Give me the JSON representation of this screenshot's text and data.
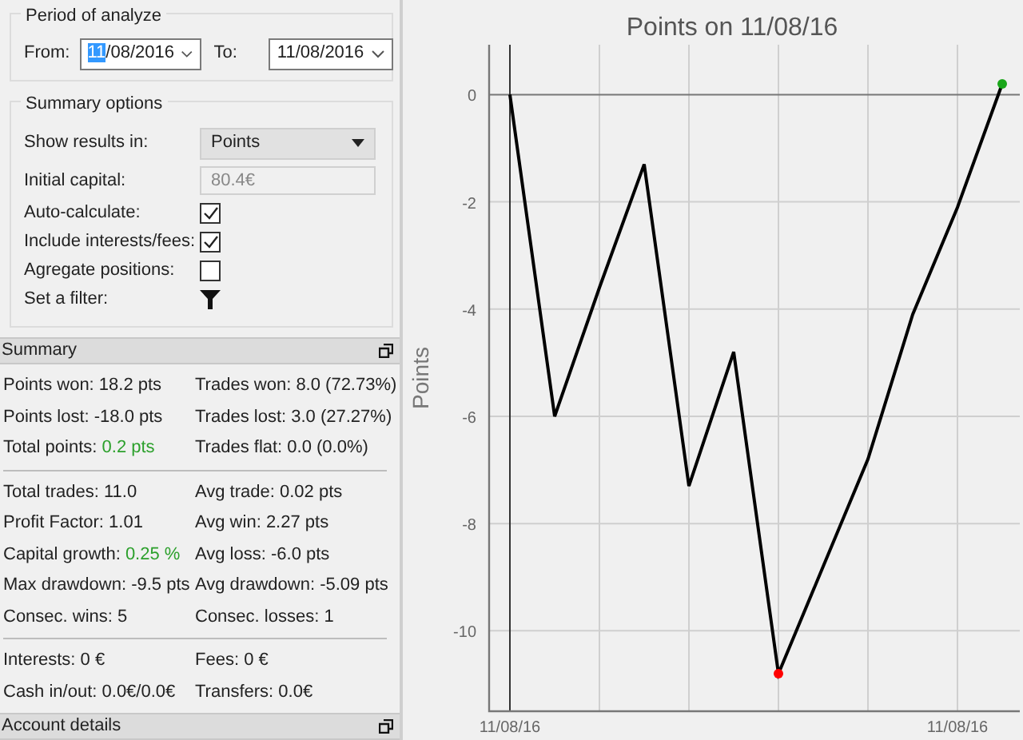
{
  "period": {
    "title": "Period of analyze",
    "from": {
      "label": "From:",
      "day": "11",
      "rest": "/08/2016"
    },
    "to": {
      "label": "To:",
      "value": "11/08/2016"
    }
  },
  "summary_options": {
    "title": "Summary options",
    "rows": [
      {
        "kind": "select",
        "label": "Show results in:",
        "value": "Points"
      },
      {
        "kind": "input",
        "label": "Initial capital:",
        "value": "80.4€",
        "disabled": true
      },
      {
        "kind": "checkbox",
        "label": "Auto-calculate:",
        "checked": true
      },
      {
        "kind": "checkbox",
        "label": "Include interests/fees:",
        "checked": true
      },
      {
        "kind": "checkbox",
        "label": "Agregate positions:",
        "checked": false
      },
      {
        "kind": "filter",
        "label": "Set a filter:"
      }
    ]
  },
  "summary": {
    "title": "Summary",
    "groups": [
      [
        {
          "label": "Points won:",
          "value": "18.2 pts"
        },
        {
          "label": "Trades won:",
          "value": "8.0 (72.73%)"
        },
        {
          "label": "Points lost:",
          "value": "-18.0 pts"
        },
        {
          "label": "Trades lost:",
          "value": "3.0 (27.27%)"
        },
        {
          "label": "Total points:",
          "value": "0.2 pts",
          "color": "#2ca02c"
        },
        {
          "label": "Trades flat:",
          "value": "0.0 (0.0%)"
        }
      ],
      [
        {
          "label": "Total trades:",
          "value": "11.0"
        },
        {
          "label": "Avg trade:",
          "value": "0.02 pts"
        },
        {
          "label": "Profit Factor:",
          "value": "1.01"
        },
        {
          "label": "Avg win:",
          "value": "2.27 pts"
        },
        {
          "label": "Capital growth:",
          "value": "0.25 %",
          "color": "#2ca02c"
        },
        {
          "label": "Avg loss:",
          "value": "-6.0 pts"
        },
        {
          "label": "Max drawdown:",
          "value": "-9.5 pts"
        },
        {
          "label": "Avg drawdown:",
          "value": "-5.09 pts"
        },
        {
          "label": "Consec. wins:",
          "value": "5"
        },
        {
          "label": "Consec. losses:",
          "value": "1"
        }
      ],
      [
        {
          "label": "Interests:",
          "value": "0 €"
        },
        {
          "label": "Fees:",
          "value": "0 €"
        },
        {
          "label": "Cash in/out:",
          "value": "0.0€/0.0€"
        },
        {
          "label": "Transfers:",
          "value": "0.0€"
        }
      ]
    ]
  },
  "account_details": {
    "title": "Account details"
  },
  "chart": {
    "chart_data": {
      "type": "line",
      "title": "Points on 11/08/16",
      "ylabel": "Points",
      "categories": [
        "11/08/16",
        null,
        null,
        null,
        null,
        null,
        null,
        null,
        null,
        null,
        "11/08/16",
        null
      ],
      "series": [
        {
          "color": "#000000",
          "values": [
            0,
            -6,
            -3.6,
            -1.3,
            -7.3,
            -4.8,
            -10.8,
            -8.8,
            -6.8,
            -4.1,
            -2.1,
            0.2
          ]
        }
      ],
      "ylim": [
        -11.5,
        0.93
      ],
      "grid": true,
      "yticks": [
        0,
        -2,
        -4,
        -6,
        -8,
        -10
      ]
    },
    "highlights": [
      {
        "kind": "lowest",
        "color": "#ff0000"
      },
      {
        "kind": "last",
        "color": "#1aa61a"
      }
    ]
  }
}
